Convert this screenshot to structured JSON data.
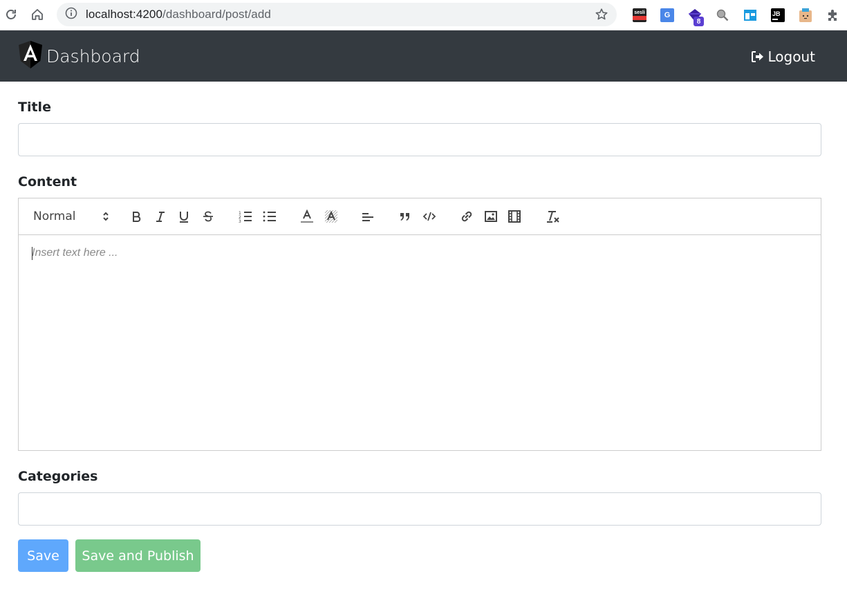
{
  "browser": {
    "url_host": "localhost:4200",
    "url_path": "/dashboard/post/add",
    "extensions": [
      {
        "name": "sesli-sozluk-extension",
        "text": "sesli",
        "color": "#222222"
      },
      {
        "name": "google-translate-extension",
        "text": "G",
        "color": "#4a86e8"
      },
      {
        "name": "gem-extension",
        "text": "",
        "color": "#3b1fa3",
        "badge": "8"
      },
      {
        "name": "search-extension",
        "text": "",
        "color": "#888888"
      },
      {
        "name": "window-extension",
        "text": "",
        "color": "#1a9be0"
      },
      {
        "name": "jetbrains-extension",
        "text": "JB",
        "color": "#000000"
      },
      {
        "name": "face-extension",
        "text": "",
        "color": "#e8b78a"
      }
    ]
  },
  "navbar": {
    "brand": "Dashboard",
    "logout": "Logout"
  },
  "form": {
    "title_label": "Title",
    "title_value": "",
    "content_label": "Content",
    "editor": {
      "header_select": "Normal",
      "placeholder": "Insert text here ...",
      "toolbar": [
        "bold-icon",
        "italic-icon",
        "underline-icon",
        "strike-icon",
        "ordered-list-icon",
        "bullet-list-icon",
        "text-color-icon",
        "background-color-icon",
        "align-icon",
        "blockquote-icon",
        "code-block-icon",
        "link-icon",
        "image-icon",
        "video-icon",
        "clear-format-icon"
      ]
    },
    "categories_label": "Categories",
    "categories_value": "",
    "save_label": "Save",
    "publish_label": "Save and Publish"
  },
  "colors": {
    "navbar": "#343a40",
    "save_button": "#5fa8fc",
    "publish_button": "#79c98c"
  }
}
